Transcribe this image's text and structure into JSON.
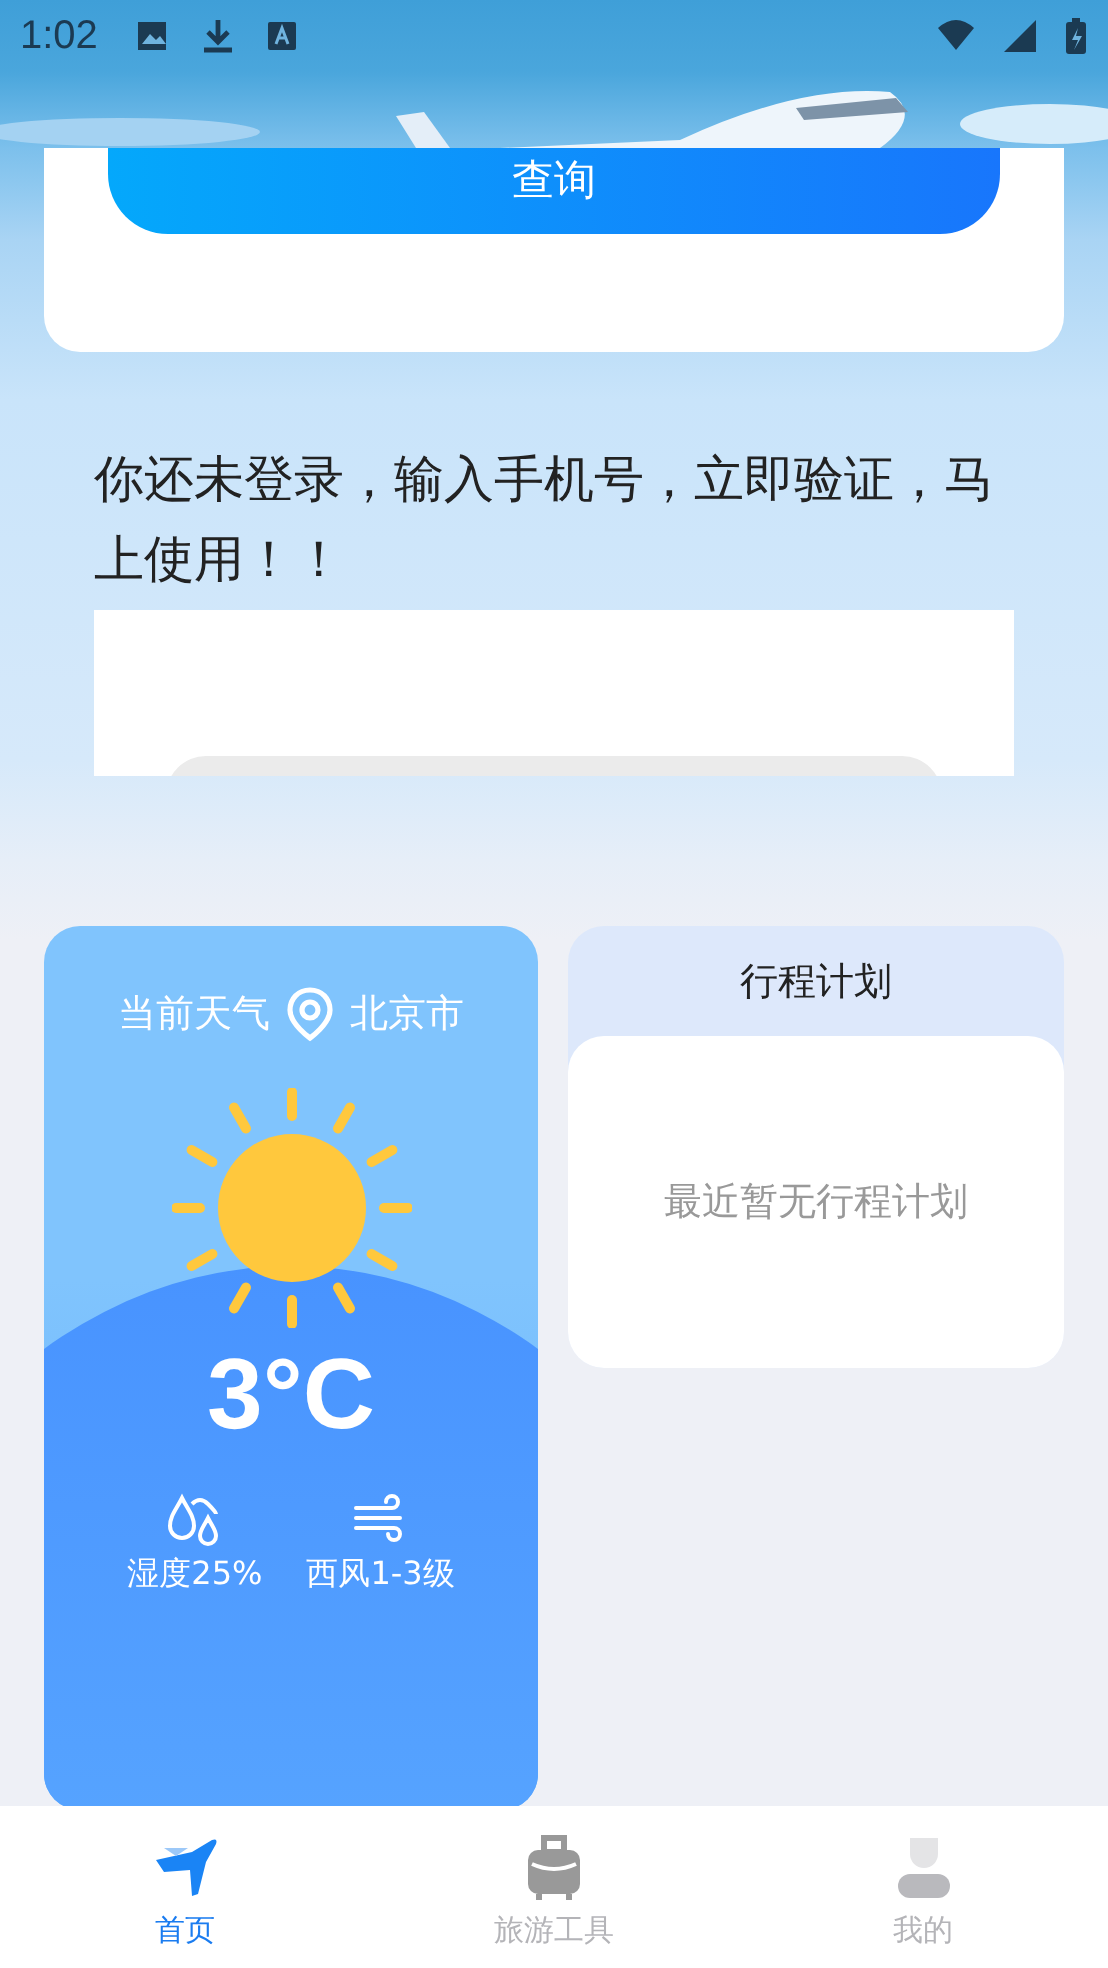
{
  "status_bar": {
    "time": "1:02"
  },
  "query_button": {
    "label": "查询"
  },
  "login_prompt": "你还未登录，输入手机号，立即验证，马上使用！！",
  "weather": {
    "title": "当前天气",
    "city": "北京市",
    "temperature": "3°C",
    "humidity": "湿度25%",
    "wind": "西风1-3级"
  },
  "plan": {
    "title": "行程计划",
    "empty_text": "最近暂无行程计划"
  },
  "tabs": [
    {
      "label": "首页",
      "selected": true
    },
    {
      "label": "旅游工具",
      "selected": false
    },
    {
      "label": "我的",
      "selected": false
    }
  ]
}
